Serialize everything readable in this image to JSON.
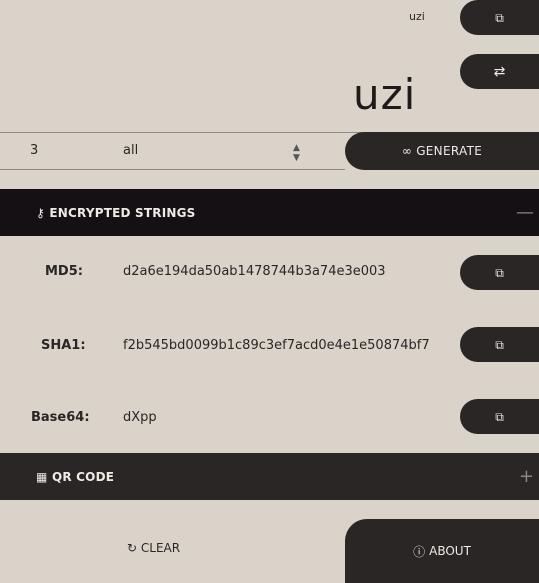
{
  "header": {
    "user_label": "uzi",
    "title": "uzi",
    "copy_icon": "copy-icon",
    "swap_icon": "swap-icon"
  },
  "controls": {
    "count_value": "3",
    "charset_value": "all",
    "generate_label": "GENERATE",
    "generate_icon": "∞"
  },
  "encrypted": {
    "section_title": "ENCRYPTED STRINGS",
    "toggle": "—",
    "rows": [
      {
        "label": "MD5:",
        "value": "d2a6e194da50ab1478744b3a74e3e003"
      },
      {
        "label": "SHA1:",
        "value": "f2b545bd0099b1c89c3ef7acd0e4e1e50874bf7"
      },
      {
        "label": "Base64:",
        "value": "dXpp"
      }
    ]
  },
  "qr": {
    "section_title": "QR CODE",
    "toggle": "+"
  },
  "footer": {
    "clear_label": "CLEAR",
    "about_label": "ABOUT"
  },
  "colors": {
    "background": "#d9d3c9",
    "dark": "#2a2626",
    "section_dark": "#141014"
  }
}
